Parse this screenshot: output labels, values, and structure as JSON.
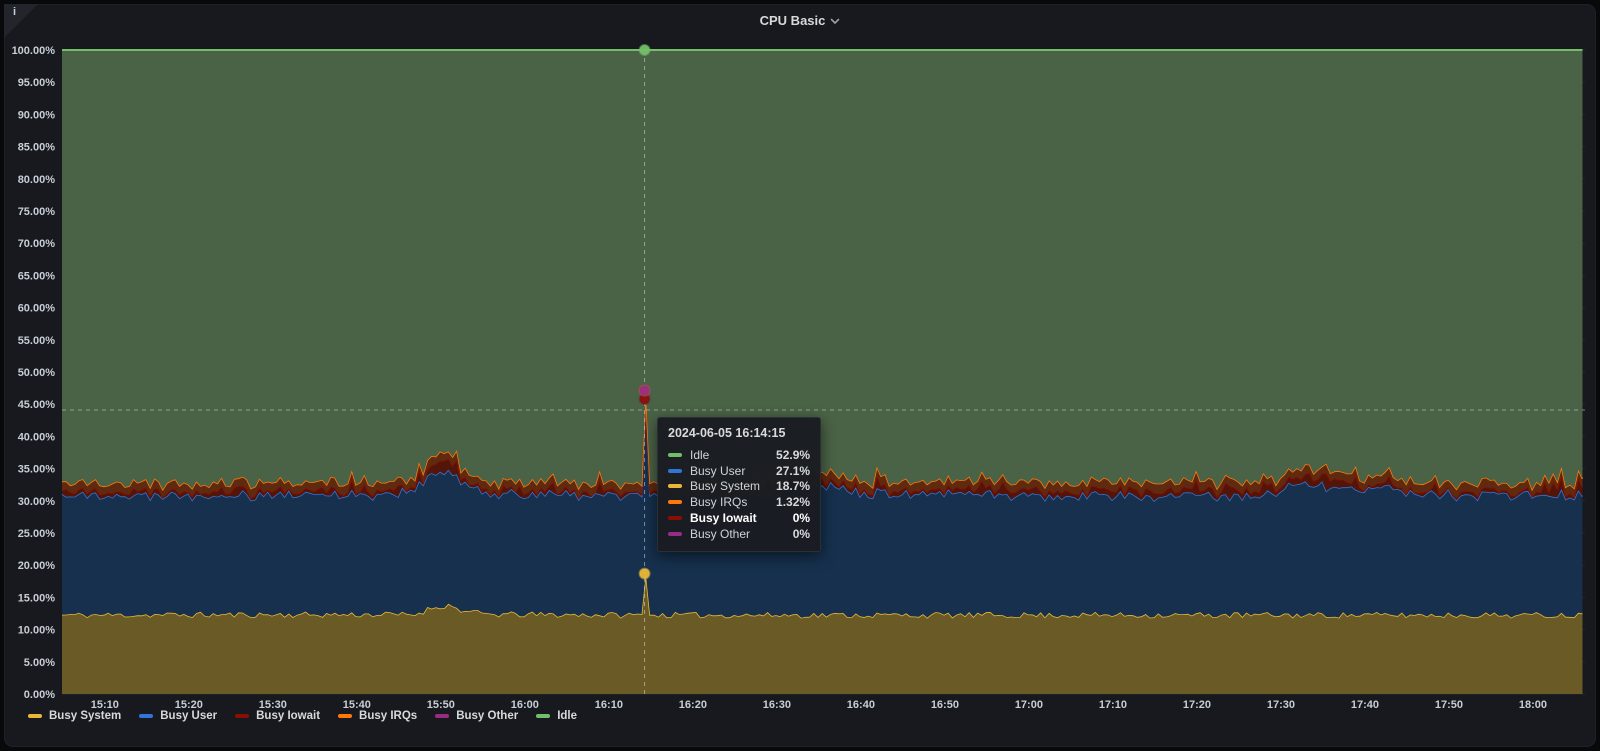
{
  "panel": {
    "title": "CPU Basic",
    "info_icon": "i",
    "chevron_icon": "chevron-down"
  },
  "tooltip": {
    "timestamp": "2024-06-05 16:14:15",
    "rows": [
      {
        "label": "Idle",
        "value": "52.9%",
        "color": "#73BF69",
        "bold": false
      },
      {
        "label": "Busy User",
        "value": "27.1%",
        "color": "#3274D9",
        "bold": false
      },
      {
        "label": "Busy System",
        "value": "18.7%",
        "color": "#EAB839",
        "bold": false
      },
      {
        "label": "Busy IRQs",
        "value": "1.32%",
        "color": "#FF780A",
        "bold": false
      },
      {
        "label": "Busy Iowait",
        "value": "0%",
        "color": "#890F02",
        "bold": true
      },
      {
        "label": "Busy Other",
        "value": "0%",
        "color": "#962D82",
        "bold": false
      }
    ]
  },
  "legend": [
    {
      "label": "Busy System",
      "color": "#EAB839"
    },
    {
      "label": "Busy User",
      "color": "#3274D9"
    },
    {
      "label": "Busy Iowait",
      "color": "#890F02"
    },
    {
      "label": "Busy IRQs",
      "color": "#FF780A"
    },
    {
      "label": "Busy Other",
      "color": "#962D82"
    },
    {
      "label": "Idle",
      "color": "#73BF69"
    }
  ],
  "chart_data": {
    "type": "area",
    "stacked": true,
    "unit": "percent",
    "ylim": [
      0,
      100
    ],
    "grid": true,
    "legend_position": "bottom",
    "t_min": 904.9,
    "t_max": 1086.2,
    "step": 0.5,
    "y_ticks": [
      "0.00%",
      "5.00%",
      "10.00%",
      "15.00%",
      "20.00%",
      "25.00%",
      "30.00%",
      "35.00%",
      "40.00%",
      "45.00%",
      "50.00%",
      "55.00%",
      "60.00%",
      "65.00%",
      "70.00%",
      "75.00%",
      "80.00%",
      "85.00%",
      "90.00%",
      "95.00%",
      "100.00%"
    ],
    "x_ticks": [
      [
        910,
        "15:10"
      ],
      [
        920,
        "15:20"
      ],
      [
        930,
        "15:30"
      ],
      [
        940,
        "15:40"
      ],
      [
        950,
        "15:50"
      ],
      [
        960,
        "16:00"
      ],
      [
        970,
        "16:10"
      ],
      [
        980,
        "16:20"
      ],
      [
        990,
        "16:30"
      ],
      [
        1000,
        "16:40"
      ],
      [
        1010,
        "16:50"
      ],
      [
        1020,
        "17:00"
      ],
      [
        1030,
        "17:10"
      ],
      [
        1040,
        "17:20"
      ],
      [
        1050,
        "17:30"
      ],
      [
        1060,
        "17:40"
      ],
      [
        1070,
        "17:50"
      ],
      [
        1080,
        "18:00"
      ]
    ],
    "cursor": {
      "t": 974.25,
      "time_label": "16:14:15",
      "y_percent": 44.1
    },
    "series": [
      {
        "name": "Busy System",
        "color": "#EAB839",
        "fill": "#6a5b26",
        "seed": 11,
        "noise": 0.45,
        "spike_prob": 0,
        "spike_amp": 0,
        "draw_line": true,
        "hover_value": 18.7,
        "keyframes": [
          [
            904.9,
            12.3
          ],
          [
            947,
            12.4
          ],
          [
            949,
            13.5
          ],
          [
            951,
            13.8
          ],
          [
            953,
            12.8
          ],
          [
            956,
            12.4
          ],
          [
            974,
            12.3
          ],
          [
            974.25,
            18.7
          ],
          [
            974.5,
            12.3
          ],
          [
            1086.2,
            12.3
          ]
        ]
      },
      {
        "name": "Busy User",
        "color": "#3274D9",
        "fill": "#16304d",
        "seed": 22,
        "noise": 0.6,
        "spike_prob": 0,
        "spike_amp": 0,
        "draw_line": true,
        "hover_value": 27.1,
        "keyframes": [
          [
            904.9,
            18.6
          ],
          [
            945,
            18.7
          ],
          [
            948,
            20.2
          ],
          [
            950,
            21.0
          ],
          [
            951.5,
            20.6
          ],
          [
            953,
            19.4
          ],
          [
            956,
            18.7
          ],
          [
            974,
            18.5
          ],
          [
            974.25,
            27.1
          ],
          [
            974.5,
            18.5
          ],
          [
            990,
            18.7
          ],
          [
            993,
            20.8
          ],
          [
            996,
            20.2
          ],
          [
            999,
            19.2
          ],
          [
            1003,
            18.7
          ],
          [
            1048,
            18.5
          ],
          [
            1052,
            20.3
          ],
          [
            1056,
            20.0
          ],
          [
            1060,
            19.0
          ],
          [
            1063,
            20.0
          ],
          [
            1066,
            18.7
          ],
          [
            1086.2,
            18.6
          ]
        ]
      },
      {
        "name": "Busy Iowait",
        "color": "#890F02",
        "fill": "#531409",
        "seed": 33,
        "noise": 0.3,
        "spike_prob": 0.15,
        "spike_amp": 1.7,
        "draw_line": true,
        "hover_value": 0,
        "keyframes": [
          [
            904.9,
            0.45
          ],
          [
            948,
            0.6
          ],
          [
            949.5,
            1.6
          ],
          [
            950.5,
            2.0
          ],
          [
            952,
            1.2
          ],
          [
            953,
            0.5
          ],
          [
            974,
            0.45
          ],
          [
            974.25,
            0
          ],
          [
            974.5,
            0.45
          ],
          [
            992,
            0.8
          ],
          [
            994,
            1.2
          ],
          [
            997,
            0.6
          ],
          [
            1052,
            0.9
          ],
          [
            1056,
            1.1
          ],
          [
            1060,
            0.5
          ],
          [
            1086.2,
            0.45
          ]
        ]
      },
      {
        "name": "Busy IRQs",
        "color": "#FF780A",
        "fill": "#5e2a10",
        "seed": 44,
        "noise": 0.25,
        "spike_prob": 0,
        "spike_amp": 0,
        "draw_line": true,
        "hover_value": 1.32,
        "keyframes": [
          [
            904.9,
            1.3
          ],
          [
            1086.2,
            1.3
          ]
        ]
      },
      {
        "name": "Busy Other",
        "color": "#962D82",
        "fill": "none",
        "seed": 55,
        "noise": 0,
        "spike_prob": 0,
        "spike_amp": 0,
        "draw_line": false,
        "hover_value": 0,
        "keyframes": [
          [
            904.9,
            0
          ],
          [
            1086.2,
            0
          ]
        ]
      },
      {
        "name": "Idle",
        "color": "#73BF69",
        "fill": "#4a6246",
        "seed": 66,
        "fill_to_100": true,
        "draw_line": true,
        "hover_value": 52.88
      }
    ]
  },
  "style_colors": {
    "panel_bg": "#17191e",
    "outer_bg": "#08090b",
    "grid_h": "rgba(216,222,227,0.07)",
    "grid_v": "rgba(216,222,227,0.05)",
    "axis_text": "#c7ced6",
    "crosshair": "rgba(205,216,230,0.55)"
  }
}
